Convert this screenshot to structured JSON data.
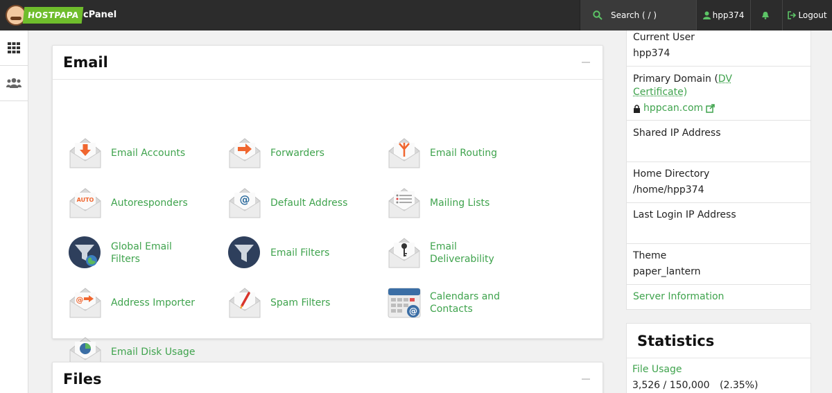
{
  "header": {
    "brand": "HOSTPAPA",
    "app_name": "cPanel",
    "search_placeholder": "Search ( / )",
    "user": "hpp374",
    "logout": "Logout"
  },
  "email_panel": {
    "title": "Email",
    "items": [
      {
        "label": "Email Accounts",
        "icon": "envelope-download-icon"
      },
      {
        "label": "Forwarders",
        "icon": "envelope-forward-icon"
      },
      {
        "label": "Email Routing",
        "icon": "envelope-routing-icon"
      },
      {
        "label": "Autoresponders",
        "icon": "envelope-auto-icon"
      },
      {
        "label": "Default Address",
        "icon": "envelope-at-icon"
      },
      {
        "label": "Mailing Lists",
        "icon": "envelope-list-icon"
      },
      {
        "label": "Global Email Filters",
        "icon": "global-filter-icon"
      },
      {
        "label": "Email Filters",
        "icon": "filter-icon"
      },
      {
        "label": "Email Deliverability",
        "icon": "envelope-key-icon"
      },
      {
        "label": "Address Importer",
        "icon": "envelope-import-icon"
      },
      {
        "label": "Spam Filters",
        "icon": "envelope-spam-icon"
      },
      {
        "label": "Calendars and Contacts",
        "icon": "calendar-icon"
      },
      {
        "label": "Email Disk Usage",
        "icon": "envelope-pie-icon"
      }
    ]
  },
  "files_panel": {
    "title": "Files"
  },
  "sidebar_info": {
    "current_user_label": "Current User",
    "current_user": "hpp374",
    "primary_domain_label": "Primary Domain (",
    "dv_link": "DV Certificate",
    "primary_domain_close": ")",
    "domain": "hppcan.com",
    "shared_ip_label": "Shared IP Address",
    "home_dir_label": "Home Directory",
    "home_dir": "/home/hpp374",
    "last_login_label": "Last Login IP Address",
    "theme_label": "Theme",
    "theme": "paper_lantern",
    "server_info": "Server Information"
  },
  "statistics": {
    "title": "Statistics",
    "file_usage_label": "File Usage",
    "file_usage_value": "3,526 / 150,000",
    "file_usage_percent": "(2.35%)"
  },
  "colors": {
    "accent": "#3fa34d",
    "topbar": "#2c2c2c",
    "brand_green": "#6fbd2c",
    "icon_orange": "#f0662f"
  }
}
